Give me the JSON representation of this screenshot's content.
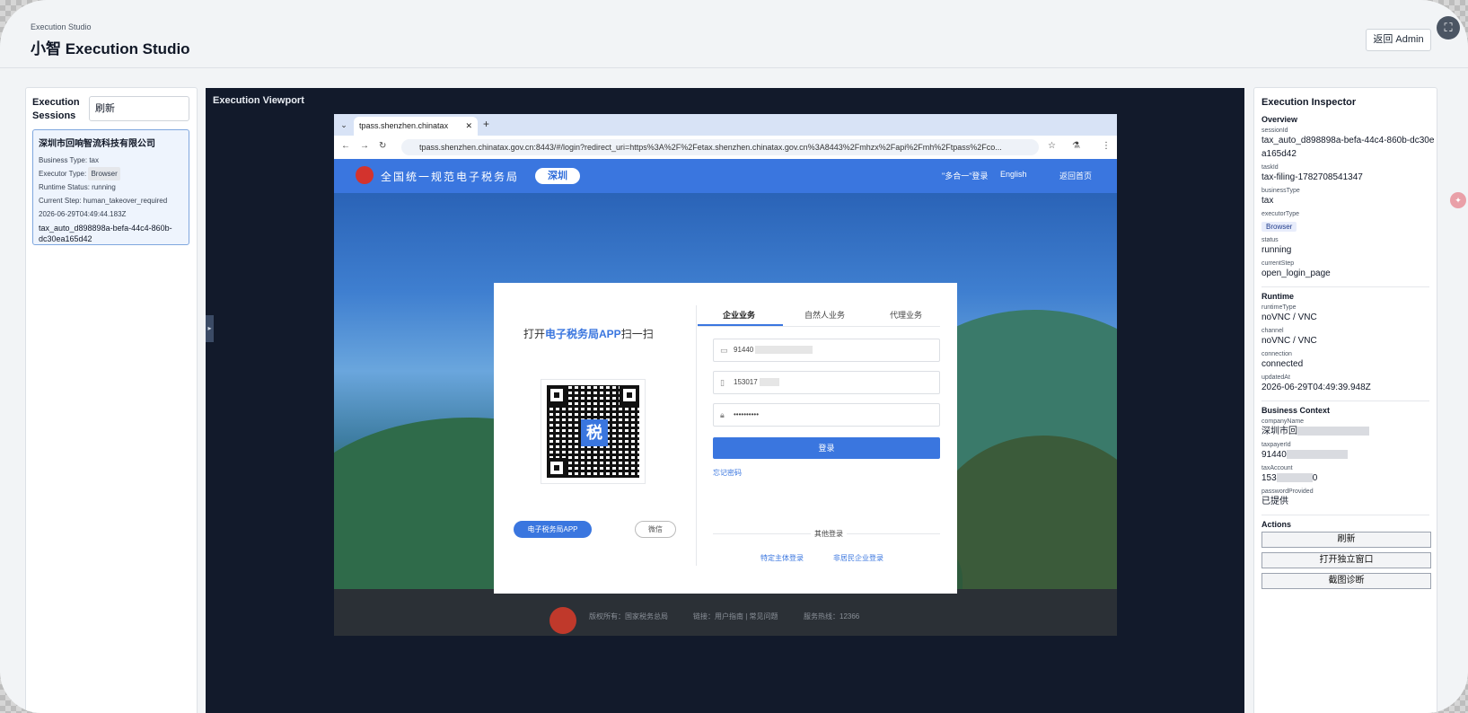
{
  "header": {
    "crumb": "Execution Studio",
    "title": "小智 Execution Studio",
    "back_label": "返回 Admin",
    "expand_icon": "expand-icon"
  },
  "left": {
    "title": "Execution Sessions",
    "refresh_label": "刷新",
    "session": {
      "name": "深圳市回响智流科技有限公司",
      "business_type": "Business Type: tax",
      "executor_label": "Executor Type:",
      "executor_value": "Browser",
      "runtime_status": "Runtime Status: running",
      "current_step": "Current Step: human_takeover_required",
      "timestamp": "2026-06-29T04:49:44.183Z",
      "session_id": "tax_auto_d898898a-befa-44c4-860b-dc30ea165d42"
    }
  },
  "viewport": {
    "title": "Execution Viewport",
    "browser": {
      "tab_title": "tpass.shenzhen.chinatax",
      "url": "tpass.shenzhen.chinatax.gov.cn:8443/#/login?redirect_uri=https%3A%2F%2Fetax.shenzhen.chinatax.gov.cn%3A8443%2Fmhzx%2Fapi%2Fmh%2Ftpass%2Fco..."
    },
    "site": {
      "name": "全国统一规范电子税务局",
      "city": "深圳",
      "link_multi": "\"多合一\"登录",
      "link_english": "English",
      "link_home": "返回首页",
      "scan_prefix": "打开",
      "scan_app": "电子税务局APP",
      "scan_suffix": "扫一扫",
      "qr_char": "税",
      "app_btn": "电子税务局APP",
      "wechat_btn": "微信",
      "tabs": [
        "企业业务",
        "自然人业务",
        "代理业务"
      ],
      "field_taxid": "91440",
      "field_phone": "153017",
      "field_password": "••••••••••",
      "login_btn": "登录",
      "forgot": "忘记密码",
      "other_login": "其他登录",
      "other_link1": "特定主体登录",
      "other_link2": "非居民企业登录",
      "footer_copyright": "版权所有：国家税务总局",
      "footer_links": "链接：用户指南 | 常见问题",
      "footer_hotline": "服务热线：12366"
    }
  },
  "inspector": {
    "title": "Execution Inspector",
    "overview_title": "Overview",
    "session_id_key": "sessionId",
    "session_id": "tax_auto_d898898a-befa-44c4-860b-dc30ea165d42",
    "task_id_key": "taskId",
    "task_id": "tax-filing-1782708541347",
    "business_type_key": "businessType",
    "business_type": "tax",
    "executor_type_key": "executorType",
    "executor_type": "Browser",
    "status_key": "status",
    "status": "running",
    "current_step_key": "currentStep",
    "current_step": "open_login_page",
    "runtime_title": "Runtime",
    "runtime_type_key": "runtimeType",
    "runtime_type": "noVNC / VNC",
    "channel_key": "channel",
    "channel": "noVNC / VNC",
    "connection_key": "connection",
    "connection": "connected",
    "updated_at_key": "updatedAt",
    "updated_at": "2026-06-29T04:49:39.948Z",
    "business_context_title": "Business Context",
    "company_name_key": "companyName",
    "company_name": "深圳市回",
    "taxpayer_id_key": "taxpayerId",
    "taxpayer_id": "91440",
    "tax_account_key": "taxAccount",
    "tax_account_prefix": "153",
    "tax_account_suffix": "0",
    "password_provided_key": "passwordProvided",
    "password_provided": "已提供",
    "actions_title": "Actions",
    "actions": [
      "刷新",
      "打开独立窗口",
      "截图诊断"
    ]
  }
}
